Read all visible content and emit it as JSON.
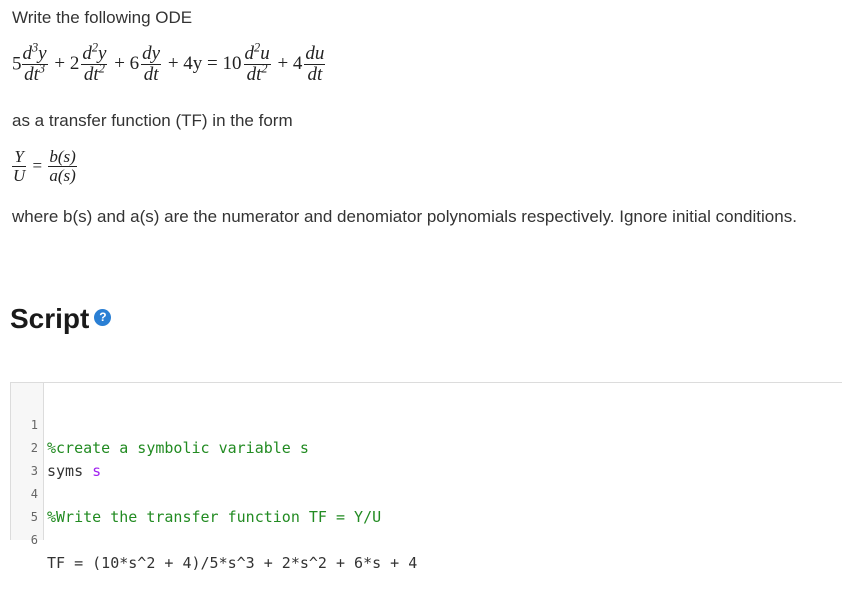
{
  "question": {
    "intro": "Write the following ODE",
    "middle": "as a transfer function (TF) in the form",
    "outro": "where b(s) and a(s) are the numerator and denomiator polynomials respectively. Ignore initial conditions."
  },
  "ode": {
    "c1": "5",
    "c2": "+ 2",
    "c3": "+ 6",
    "c4": "+ 4y = 10",
    "c5": "+ 4",
    "d3y": "d",
    "d3y_den": "dt",
    "dy": "dy",
    "dt": "dt",
    "du": "du"
  },
  "tf": {
    "num_top": "Y",
    "num_bot": "U",
    "eq": "=",
    "b": "b(s)",
    "a": "a(s)"
  },
  "script": {
    "heading": "Script",
    "help_icon": "?",
    "lines": [
      {
        "n": "1",
        "text": "%create a symbolic variable s"
      },
      {
        "n": "2",
        "kw": "syms ",
        "arg": "s"
      },
      {
        "n": "3",
        "text": ""
      },
      {
        "n": "4",
        "text": "%Write the transfer function TF = Y/U"
      },
      {
        "n": "5",
        "text": ""
      },
      {
        "n": "6",
        "text": "TF = (10*s^2 + 4)/5*s^3 + 2*s^2 + 6*s + 4"
      }
    ]
  }
}
